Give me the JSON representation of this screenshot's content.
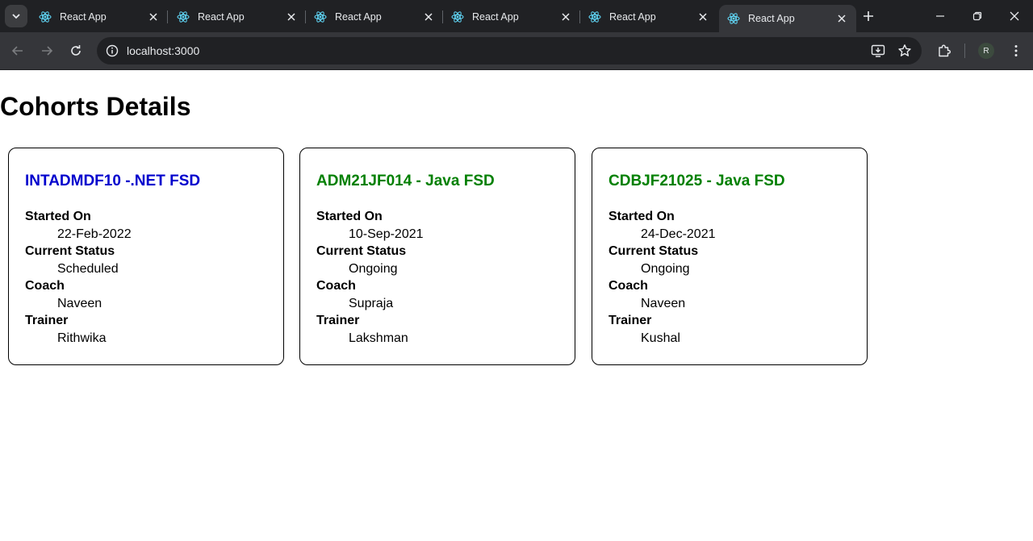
{
  "browser": {
    "tabs": [
      {
        "title": "React App"
      },
      {
        "title": "React App"
      },
      {
        "title": "React App"
      },
      {
        "title": "React App"
      },
      {
        "title": "React App"
      },
      {
        "title": "React App"
      }
    ],
    "active_tab_index": 5,
    "url": "localhost:3000",
    "profile_initial": "R"
  },
  "page": {
    "title": "Cohorts Details",
    "labels": {
      "started_on": "Started On",
      "current_status": "Current Status",
      "coach": "Coach",
      "trainer": "Trainer"
    },
    "cohorts": [
      {
        "code": "INTADMDF10 -.NET FSD",
        "started_on": "22-Feb-2022",
        "status": "Scheduled",
        "coach": "Naveen",
        "trainer": "Rithwika",
        "title_color": "#0000cd"
      },
      {
        "code": "ADM21JF014 - Java FSD",
        "started_on": "10-Sep-2021",
        "status": "Ongoing",
        "coach": "Supraja",
        "trainer": "Lakshman",
        "title_color": "#008000"
      },
      {
        "code": "CDBJF21025 - Java FSD",
        "started_on": "24-Dec-2021",
        "status": "Ongoing",
        "coach": "Naveen",
        "trainer": "Kushal",
        "title_color": "#008000"
      }
    ]
  }
}
